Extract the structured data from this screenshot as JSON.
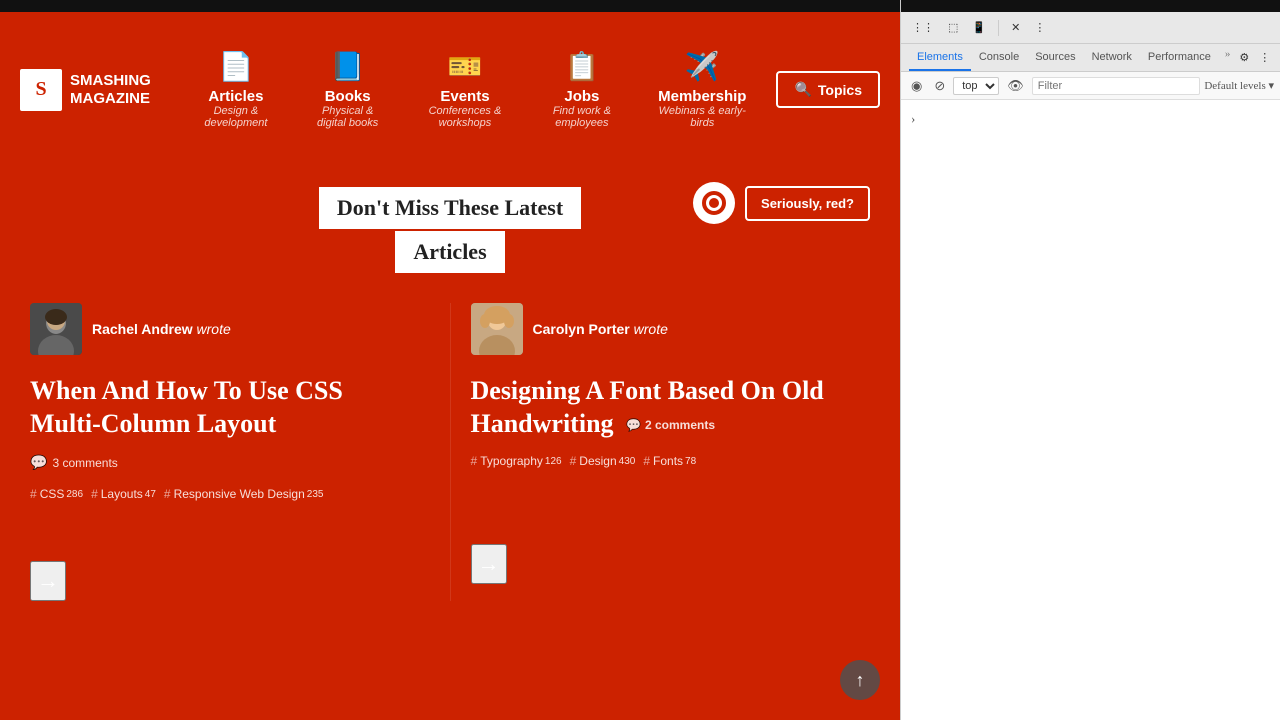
{
  "website": {
    "background_color": "#cc2200",
    "top_bar": {
      "color": "#111"
    },
    "logo": {
      "icon_letter": "S",
      "line1": "SMASHING",
      "line2": "MAGAZINE"
    },
    "nav": {
      "items": [
        {
          "label": "Articles",
          "sublabel": "Design & development",
          "icon": "📄"
        },
        {
          "label": "Books",
          "sublabel": "Physical & digital books",
          "icon": "📘"
        },
        {
          "label": "Events",
          "sublabel": "Conferences & workshops",
          "icon": "🎫"
        },
        {
          "label": "Jobs",
          "sublabel": "Find work & employees",
          "icon": "📋"
        },
        {
          "label": "Membership",
          "sublabel": "Webinars & early-birds",
          "icon": "✈️"
        }
      ],
      "topics_btn_label": "Topics",
      "topics_icon": "🔍"
    },
    "hero": {
      "title_line1": "Don't Miss These Latest",
      "title_line2": "Articles",
      "ad_btn_label": "Seriously, red?",
      "ad_icon": "🔴"
    },
    "articles": [
      {
        "author_name": "Rachel Andrew",
        "author_wrote": "wrote",
        "title": "When And How To Use CSS Multi-Column Layout",
        "comments_count": "3 comments",
        "tags": [
          {
            "name": "CSS",
            "count": "286"
          },
          {
            "name": "Layouts",
            "count": "47"
          },
          {
            "name": "Responsive Web Design",
            "count": "235"
          }
        ]
      },
      {
        "author_name": "Carolyn Porter",
        "author_wrote": "wrote",
        "title": "Designing A Font Based On Old Handwriting",
        "comments_count": "2 comments",
        "tags": [
          {
            "name": "Typography",
            "count": "126"
          },
          {
            "name": "Design",
            "count": "430"
          },
          {
            "name": "Fonts",
            "count": "78"
          }
        ]
      }
    ],
    "arrow_label": "→",
    "scroll_up_label": "↑"
  },
  "devtools": {
    "toolbar_buttons": [
      "⋮⋮",
      "←",
      "↺",
      "⊗",
      "🔍"
    ],
    "tabs": [
      {
        "label": "Elements",
        "active": true
      },
      {
        "label": "Console",
        "active": false
      },
      {
        "label": "Sources",
        "active": false
      },
      {
        "label": "Network",
        "active": false
      },
      {
        "label": "Performance",
        "active": false
      }
    ],
    "more_label": "»",
    "settings_icon": "⚙",
    "second_bar": {
      "icons": [
        "◉",
        "⊘",
        "🔍"
      ],
      "select_value": "top",
      "filter_placeholder": "Filter",
      "levels_label": "Default levels ▾"
    },
    "console_prefix": ">"
  }
}
